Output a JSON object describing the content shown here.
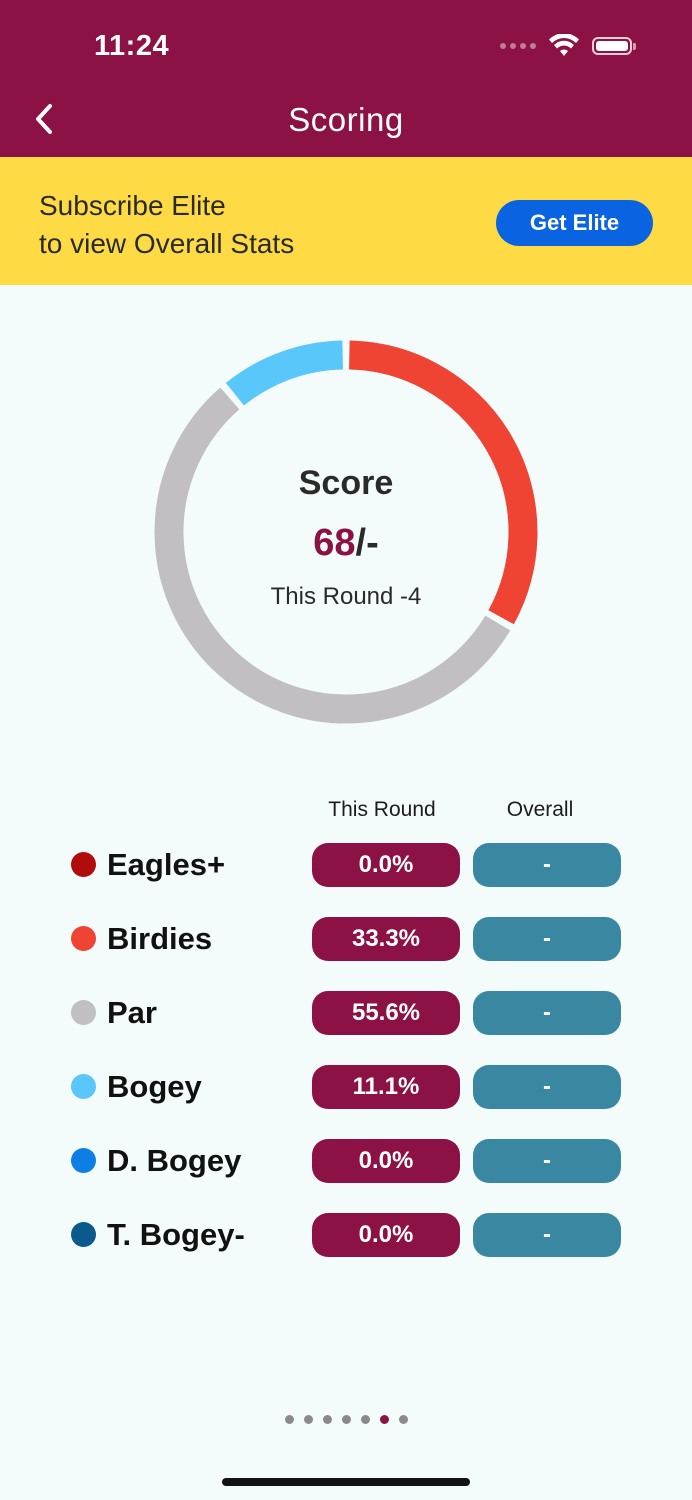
{
  "status_bar": {
    "time": "11:24"
  },
  "nav": {
    "title": "Scoring"
  },
  "promo": {
    "line1": "Subscribe Elite",
    "line2": "to view Overall Stats",
    "button_label": "Get Elite"
  },
  "score": {
    "label": "Score",
    "value": "68",
    "suffix": "/-",
    "subtitle": "This Round -4"
  },
  "columns": {
    "this_round": "This Round",
    "overall": "Overall"
  },
  "stats": [
    {
      "label": "Eagles+",
      "this_round": "0.0%",
      "overall": "-",
      "color": "#b10c0c",
      "fraction": 0.0
    },
    {
      "label": "Birdies",
      "this_round": "33.3%",
      "overall": "-",
      "color": "#ef4433",
      "fraction": 0.333
    },
    {
      "label": "Par",
      "this_round": "55.6%",
      "overall": "-",
      "color": "#c1bfc1",
      "fraction": 0.556
    },
    {
      "label": "Bogey",
      "this_round": "11.1%",
      "overall": "-",
      "color": "#5ac7fa",
      "fraction": 0.111
    },
    {
      "label": "D. Bogey",
      "this_round": "0.0%",
      "overall": "-",
      "color": "#0d7ee3",
      "fraction": 0.0
    },
    {
      "label": "T. Bogey-",
      "this_round": "0.0%",
      "overall": "-",
      "color": "#0b5a8c",
      "fraction": 0.0
    }
  ],
  "pagination": {
    "count": 7,
    "active_index": 5
  },
  "colors": {
    "brand": "#8c1246",
    "banner": "#fedb44",
    "accent_button": "#0a63e0",
    "overall_pill": "#3a87a2"
  }
}
